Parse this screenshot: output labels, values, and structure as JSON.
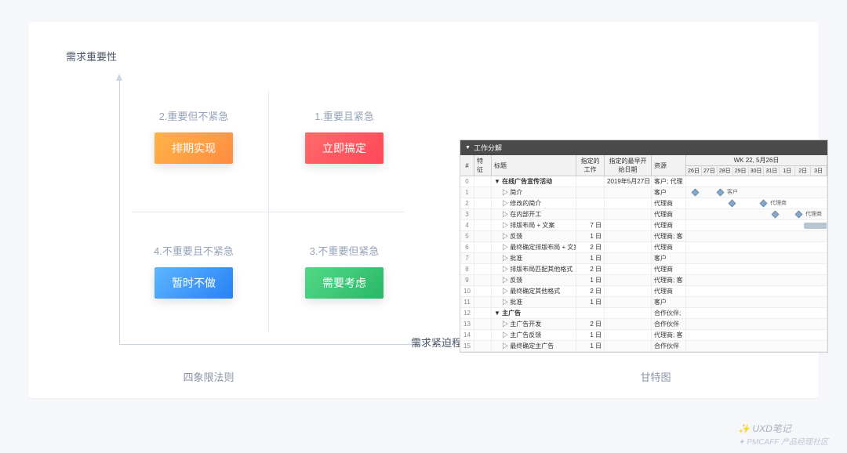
{
  "quadrant": {
    "y_axis_label": "需求重要性",
    "x_axis_label": "需求紧迫程度",
    "q1": {
      "title": "2.重要但不紧急",
      "button": "排期实现"
    },
    "q2": {
      "title": "1.重要且紧急",
      "button": "立即搞定"
    },
    "q3": {
      "title": "4.不重要且不紧急",
      "button": "暂时不做"
    },
    "q4": {
      "title": "3.不重要但紧急",
      "button": "需要考虑"
    },
    "caption": "四象限法则"
  },
  "gantt": {
    "title": "工作分解",
    "caption": "甘特图",
    "headers": {
      "num": "#",
      "idx": "特征",
      "title": "标题",
      "a1": "指定的工作",
      "a2": "指定的最早开始日期",
      "res": "资源",
      "week": "WK 22, 5月26日"
    },
    "days": [
      "26日",
      "27日",
      "28日",
      "29日",
      "30日",
      "31日",
      "1日",
      "2日",
      "3日"
    ],
    "rows": [
      {
        "n": "0",
        "i": "",
        "title": "▼ 在线广告宣传活动",
        "a": "",
        "b": "2019年5月27日",
        "r": "客户; 代理",
        "bold": true,
        "bar": null
      },
      {
        "n": "1",
        "i": "",
        "title": "▷ 简介",
        "a": "",
        "b": "",
        "r": "客户",
        "d1": 8,
        "d2": 40,
        "lbl": "客户"
      },
      {
        "n": "2",
        "i": "",
        "title": "▷ 修改的简介",
        "a": "",
        "b": "",
        "r": "代理商",
        "d1": 55,
        "d2": 95,
        "lbl": "代理商"
      },
      {
        "n": "3",
        "i": "",
        "title": "▷ 在内部开工",
        "a": "",
        "b": "",
        "r": "代理商",
        "d1": 110,
        "d2": 140,
        "lbl": "代理商"
      },
      {
        "n": "4",
        "i": "",
        "title": "▷ 排版布局 + 文案",
        "a": "7 日",
        "b": "",
        "r": "代理商",
        "bar": {
          "l": 150,
          "w": 30
        }
      },
      {
        "n": "5",
        "i": "",
        "title": "▷ 反馈",
        "a": "1 日",
        "b": "",
        "r": "代理商; 客"
      },
      {
        "n": "6",
        "i": "",
        "title": "▷ 最终确定排版布局 + 文案",
        "a": "2 日",
        "b": "",
        "r": "代理商"
      },
      {
        "n": "7",
        "i": "",
        "title": "▷ 批准",
        "a": "1 日",
        "b": "",
        "r": "客户"
      },
      {
        "n": "8",
        "i": "",
        "title": "▷ 排版布局匹配其他格式",
        "a": "2 日",
        "b": "",
        "r": "代理商"
      },
      {
        "n": "9",
        "i": "",
        "title": "▷ 反馈",
        "a": "1 日",
        "b": "",
        "r": "代理商; 客"
      },
      {
        "n": "10",
        "i": "",
        "title": "▷ 最终确定其他格式",
        "a": "2 日",
        "b": "",
        "r": "代理商"
      },
      {
        "n": "11",
        "i": "",
        "title": "▷ 批准",
        "a": "1 日",
        "b": "",
        "r": "客户"
      },
      {
        "n": "12",
        "i": "",
        "title": "▼ 主广告",
        "a": "",
        "b": "",
        "r": "合作伙伴;",
        "bold": true
      },
      {
        "n": "13",
        "i": "",
        "title": "▷ 主广告开发",
        "a": "2 日",
        "b": "",
        "r": "合作伙伴"
      },
      {
        "n": "14",
        "i": "",
        "title": "▷ 主广告反馈",
        "a": "1 日",
        "b": "",
        "r": "代理商; 客"
      },
      {
        "n": "15",
        "i": "",
        "title": "▷ 最终确定主广告",
        "a": "1 日",
        "b": "",
        "r": "合作伙伴"
      }
    ]
  },
  "watermark": {
    "line1": "✨ UXD笔记",
    "line2": "✦ PMCAFF 产品经理社区"
  }
}
